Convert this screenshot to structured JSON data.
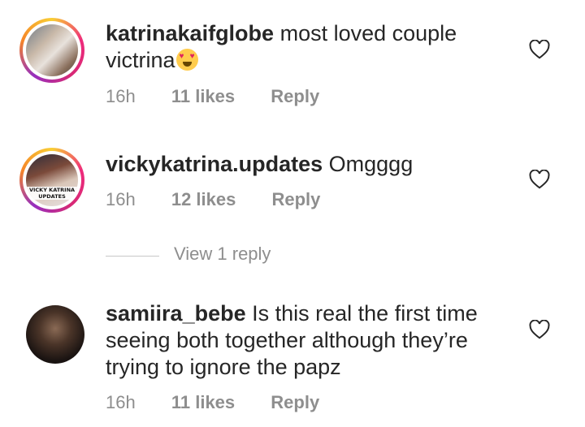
{
  "comments": [
    {
      "username": "katrinakaifglobe",
      "text": "most loved couple victrina",
      "emoji": "heart-eyes-emoji",
      "time": "16h",
      "likes": "11 likes",
      "reply": "Reply"
    },
    {
      "username": "vickykatrina.updates",
      "text": "Omgggg",
      "avatar_caption": "VICKY KATRINA UPDATES",
      "time": "16h",
      "likes": "12 likes",
      "reply": "Reply"
    },
    {
      "username": "samiira_bebe",
      "text": "Is this real the first time seeing both together although they’re trying to ignore the papz",
      "time": "16h",
      "likes": "11 likes",
      "reply": "Reply"
    }
  ],
  "view_replies": "View 1 reply",
  "icons": {
    "like": "heart-outline-icon",
    "avatar_ring": "story-ring"
  },
  "colors": {
    "text": "#262626",
    "meta": "#8e8e8e",
    "divider": "#c7c7c7"
  }
}
